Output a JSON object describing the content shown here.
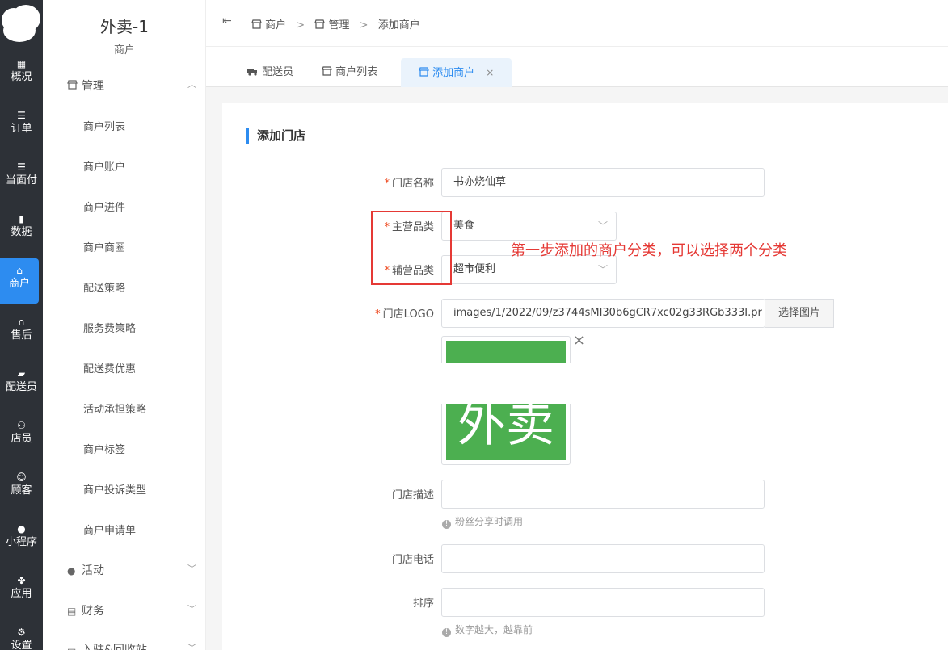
{
  "rail": {
    "items": [
      {
        "label": "概况",
        "icon": "dashboard-icon"
      },
      {
        "label": "订单",
        "icon": "list-icon"
      },
      {
        "label": "当面付",
        "icon": "list-icon"
      },
      {
        "label": "数据",
        "icon": "bar-chart-icon"
      },
      {
        "label": "商户",
        "icon": "store-icon"
      },
      {
        "label": "售后",
        "icon": "headset-icon"
      },
      {
        "label": "配送员",
        "icon": "delivery-icon"
      },
      {
        "label": "店员",
        "icon": "staff-icon"
      },
      {
        "label": "顾客",
        "icon": "customer-icon"
      },
      {
        "label": "小程序",
        "icon": "wechat-icon"
      },
      {
        "label": "应用",
        "icon": "apps-icon"
      },
      {
        "label": "设置",
        "icon": "settings-icon"
      }
    ],
    "active_index": 4,
    "active_color": "#2d8cf0"
  },
  "sidebar": {
    "title": "外卖-1",
    "subtitle": "商户",
    "groups": [
      {
        "label": "管理",
        "icon": "store-icon",
        "expanded": true
      },
      {
        "label": "活动",
        "icon": "user-circle-icon",
        "expanded": false
      },
      {
        "label": "财务",
        "icon": "finance-icon",
        "expanded": false
      },
      {
        "label": "入驻&回收站",
        "icon": "inbox-icon",
        "expanded": false
      }
    ],
    "items": [
      "商户列表",
      "商户账户",
      "商户进件",
      "商户商圈",
      "配送策略",
      "服务费策略",
      "配送费优惠",
      "活动承担策略",
      "商户标签",
      "商户投诉类型",
      "商户申请单"
    ]
  },
  "breadcrumb": {
    "items": [
      "商户",
      "管理",
      "添加商户"
    ],
    "separator": ">"
  },
  "tabs": [
    {
      "label": "配送员",
      "icon": "delivery-icon"
    },
    {
      "label": "商户列表",
      "icon": "store-icon"
    },
    {
      "label": "添加商户",
      "icon": "store-icon",
      "active": true,
      "close": "×"
    }
  ],
  "form": {
    "title": "添加门店",
    "store_name": {
      "label": "门店名称",
      "value": "书亦烧仙草",
      "required": true
    },
    "main_category": {
      "label": "主营品类",
      "value": "美食",
      "required": true
    },
    "sub_category": {
      "label": "辅营品类",
      "value": "超市便利",
      "required": true
    },
    "logo": {
      "label": "门店LOGO",
      "value": "images/1/2022/09/z3744sMI30b6gCR7xc02g33RGb333I.pr",
      "button": "选择图片",
      "required": true,
      "image_text": "外卖",
      "image_color": "#4caf50",
      "close": "×"
    },
    "description": {
      "label": "门店描述",
      "value": "",
      "hint": "粉丝分享时调用"
    },
    "phone": {
      "label": "门店电话",
      "value": ""
    },
    "sort": {
      "label": "排序",
      "value": "",
      "hint": "数字越大，越靠前"
    }
  },
  "annotation": {
    "text": "第一步添加的商户分类，可以选择两个分类",
    "color": "#e53935"
  }
}
